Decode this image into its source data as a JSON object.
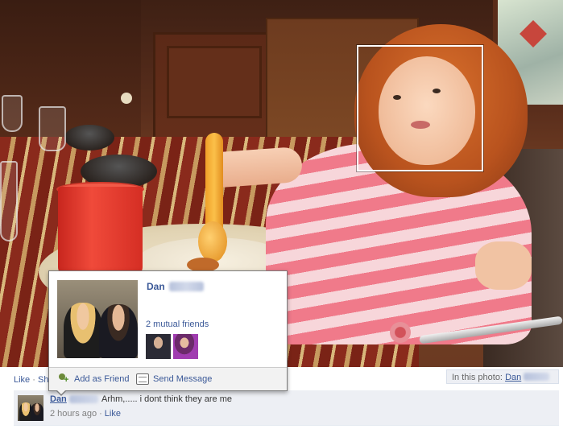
{
  "hovercard": {
    "name": "Dan",
    "mutual_friends": "2 mutual friends",
    "actions": {
      "add_friend": "Add as Friend",
      "send_message": "Send Message"
    },
    "icons": {
      "add_friend": "add-friend-icon",
      "send_message": "message-icon"
    }
  },
  "photo_actions": {
    "like": "Like",
    "separator": "·",
    "share": "Sh"
  },
  "in_this_photo": {
    "label": "In this photo:",
    "name": "Dan"
  },
  "comment": {
    "author": "Dan",
    "text": "Arhm,..... i dont think they are me",
    "time": "2 hours ago",
    "separator": "·",
    "like": "Like"
  },
  "colors": {
    "link": "#3b5998",
    "panel_bg": "#edeff4",
    "face_box": "#ffffff"
  }
}
